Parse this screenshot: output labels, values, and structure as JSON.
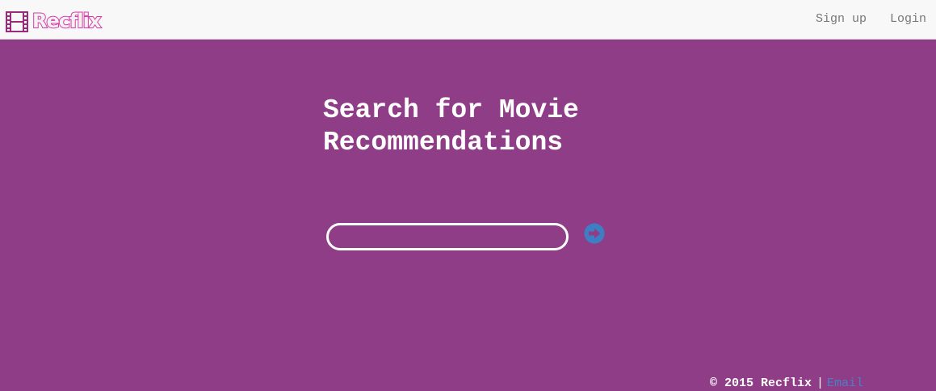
{
  "navbar": {
    "brand": "Recflix",
    "brand_icon": "film-icon",
    "links": [
      "Sign up",
      "Login"
    ]
  },
  "hero": {
    "title": "Search for Movie Recommendations"
  },
  "search": {
    "value": "",
    "placeholder": "",
    "submit_icon": "arrow-right-circle-icon"
  },
  "footer": {
    "copyright": "© 2015 Recflix",
    "separator": "|",
    "email_link": "Email"
  },
  "colors": {
    "background": "#8f3d87",
    "navbar": "#f8f8f8",
    "brand": "#d93aa8",
    "link": "#4a7fc8"
  }
}
